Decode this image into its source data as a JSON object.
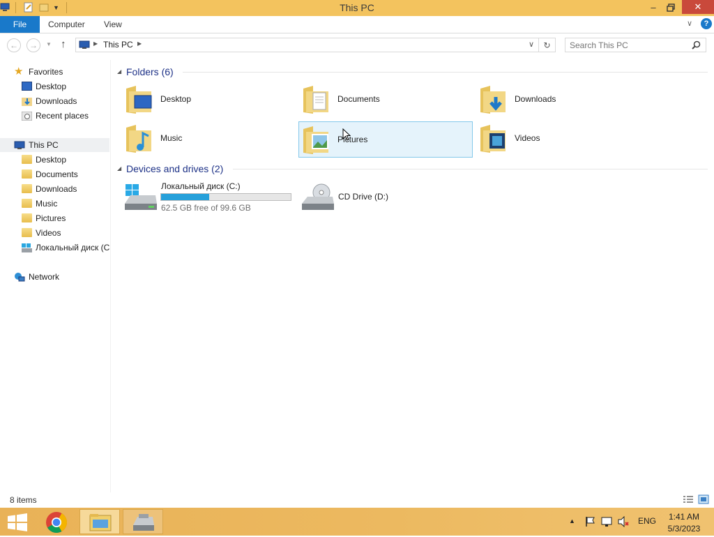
{
  "window": {
    "title": "This PC"
  },
  "ribbon": {
    "tabs": [
      "File",
      "Computer",
      "View"
    ]
  },
  "address": {
    "location": "This PC"
  },
  "search": {
    "placeholder": "Search This PC"
  },
  "nav": {
    "favorites": {
      "label": "Favorites",
      "items": [
        "Desktop",
        "Downloads",
        "Recent places"
      ]
    },
    "this_pc": {
      "label": "This PC",
      "items": [
        "Desktop",
        "Documents",
        "Downloads",
        "Music",
        "Pictures",
        "Videos",
        "Локальный диск (C"
      ]
    },
    "network": {
      "label": "Network"
    }
  },
  "folders": {
    "header": "Folders (6)",
    "items": [
      "Desktop",
      "Documents",
      "Downloads",
      "Music",
      "Pictures",
      "Videos"
    ],
    "selected": "Pictures"
  },
  "drives": {
    "header": "Devices and drives (2)",
    "items": [
      {
        "name": "Локальный диск (C:)",
        "free_text": "62.5 GB free of 99.6 GB",
        "used_fraction": 0.373,
        "bar_color": "#26a0da"
      },
      {
        "name": "CD Drive (D:)"
      }
    ]
  },
  "status": {
    "text": "8 items"
  },
  "taskbar": {
    "apps": [
      "windows-start",
      "chrome",
      "file-explorer",
      "drive-tool"
    ],
    "language": "ENG",
    "time": "1:41 AM",
    "date": "5/3/2023"
  },
  "colors": {
    "title_bar": "#f3c35e",
    "file_tab": "#1979ca",
    "close_button": "#c9493b",
    "selection": "#e5f3fb",
    "taskbar": "#ecb960"
  }
}
